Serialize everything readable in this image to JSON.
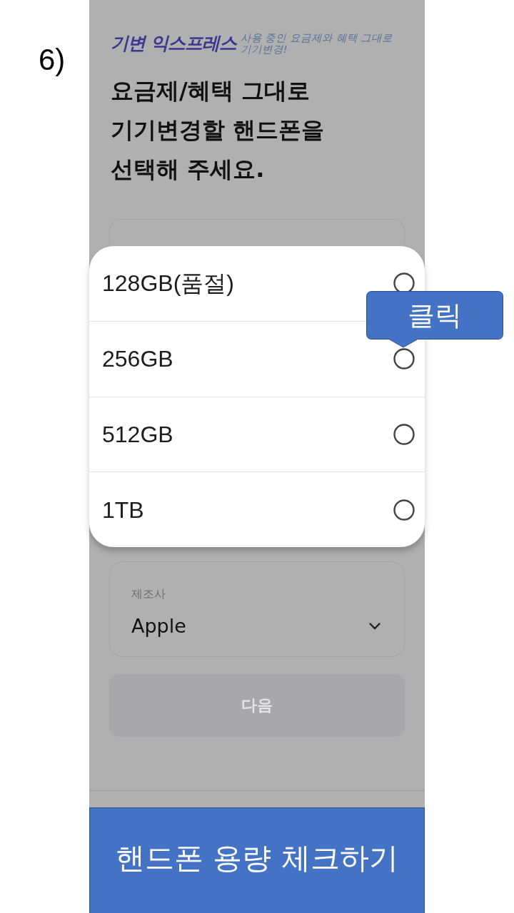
{
  "step_label": "6)",
  "header": {
    "logo": "기변 익스프레스",
    "tagline_lines": [
      "사용 중인 요금제와 혜택 그대로",
      "기기변경!"
    ]
  },
  "title_lines": [
    "요금제/혜택 그대로",
    "기기변경할 핸드폰을",
    "선택해 주세요."
  ],
  "options": [
    {
      "label": "128GB(품절)",
      "selected": false
    },
    {
      "label": "256GB",
      "selected": false
    },
    {
      "label": "512GB",
      "selected": false
    },
    {
      "label": "1TB",
      "selected": false
    }
  ],
  "callout": {
    "text": "클릭"
  },
  "manufacturer_field": {
    "label": "제조사",
    "value": "Apple"
  },
  "next_button": {
    "label": "다음",
    "disabled": true
  },
  "banner": {
    "text": "핸드폰 용량 체크하기"
  }
}
